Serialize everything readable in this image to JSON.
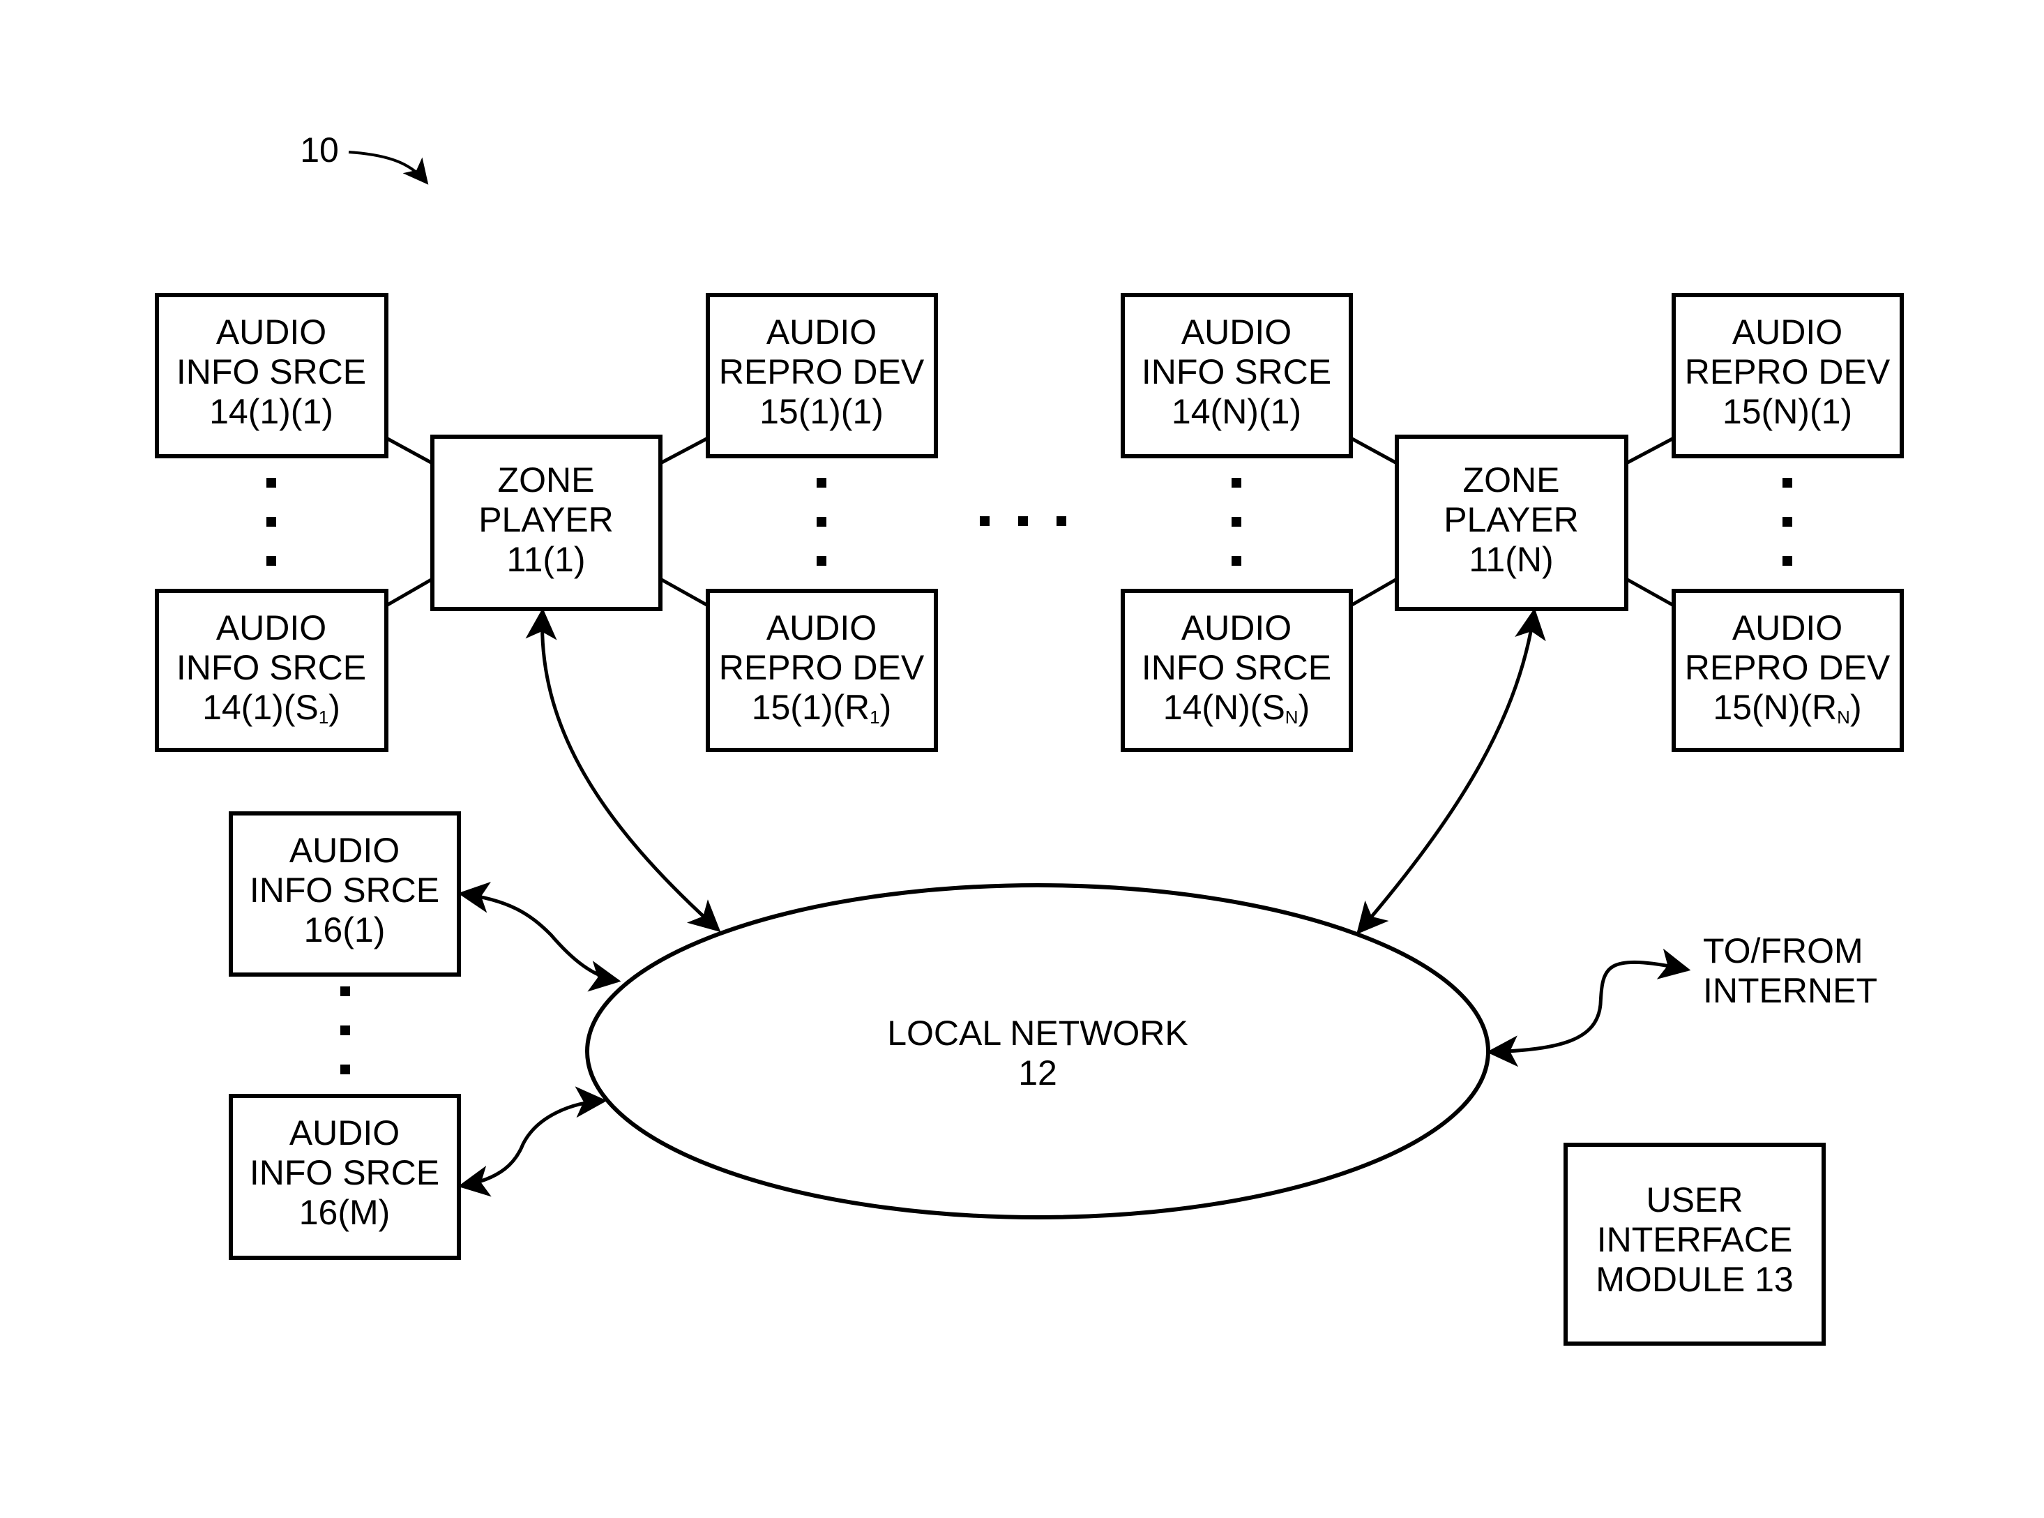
{
  "figure_ref": "10",
  "network": {
    "line1": "LOCAL NETWORK",
    "line2": "12"
  },
  "internet": {
    "line1": "TO/FROM",
    "line2": "INTERNET"
  },
  "ui_module": {
    "line1": "USER",
    "line2": "INTERFACE",
    "line3": "MODULE 13"
  },
  "zones": [
    {
      "player": {
        "line1": "ZONE",
        "line2": "PLAYER",
        "line3": "11(1)"
      },
      "src_first": {
        "line1": "AUDIO",
        "line2": "INFO SRCE",
        "line3": "14(1)(1)"
      },
      "src_last": {
        "line1": "AUDIO",
        "line2": "INFO SRCE",
        "line3_pre": "14(1)(S",
        "line3_sub": "1",
        "line3_post": ")"
      },
      "dev_first": {
        "line1": "AUDIO",
        "line2": "REPRO DEV",
        "line3": "15(1)(1)"
      },
      "dev_last": {
        "line1": "AUDIO",
        "line2": "REPRO DEV",
        "line3_pre": "15(1)(R",
        "line3_sub": "1",
        "line3_post": ")"
      }
    },
    {
      "player": {
        "line1": "ZONE",
        "line2": "PLAYER",
        "line3": "11(N)"
      },
      "src_first": {
        "line1": "AUDIO",
        "line2": "INFO SRCE",
        "line3": "14(N)(1)"
      },
      "src_last": {
        "line1": "AUDIO",
        "line2": "INFO SRCE",
        "line3_pre": "14(N)(S",
        "line3_sub": "N",
        "line3_post": ")"
      },
      "dev_first": {
        "line1": "AUDIO",
        "line2": "REPRO DEV",
        "line3": "15(N)(1)"
      },
      "dev_last": {
        "line1": "AUDIO",
        "line2": "REPRO DEV",
        "line3_pre": "15(N)(R",
        "line3_sub": "N",
        "line3_post": ")"
      }
    }
  ],
  "network_sources": [
    {
      "line1": "AUDIO",
      "line2": "INFO SRCE",
      "line3": "16(1)"
    },
    {
      "line1": "AUDIO",
      "line2": "INFO SRCE",
      "line3": "16(M)"
    }
  ]
}
